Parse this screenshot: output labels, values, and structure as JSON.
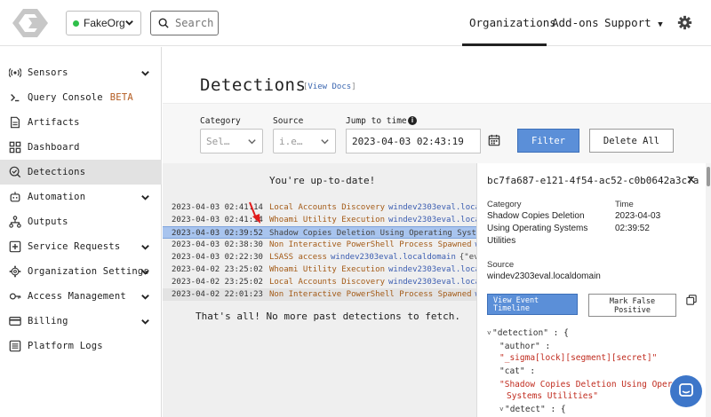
{
  "header": {
    "org_name": "FakeOrg",
    "search_placeholder": "Search",
    "nav": {
      "organizations": "Organizations",
      "addons": "Add-ons",
      "support": "Support"
    }
  },
  "sidebar": {
    "items": [
      {
        "label": "Sensors",
        "icon": "sensors-icon"
      },
      {
        "label": "Query Console",
        "badge": "BETA",
        "icon": "query-console-icon"
      },
      {
        "label": "Artifacts",
        "icon": "artifacts-icon"
      },
      {
        "label": "Dashboard",
        "icon": "dashboard-icon"
      },
      {
        "label": "Detections",
        "icon": "detections-icon",
        "active": true
      },
      {
        "label": "Automation",
        "icon": "automation-icon"
      },
      {
        "label": "Outputs",
        "icon": "outputs-icon"
      },
      {
        "label": "Service Requests",
        "icon": "service-requests-icon"
      },
      {
        "label": "Organization Settings",
        "icon": "organization-settings-icon"
      },
      {
        "label": "Access Management",
        "icon": "access-management-icon"
      },
      {
        "label": "Billing",
        "icon": "billing-icon"
      },
      {
        "label": "Platform Logs",
        "icon": "platform-logs-icon"
      }
    ]
  },
  "page": {
    "title": "Detections",
    "view_docs": "View Docs",
    "filters": {
      "category_label": "Category",
      "category_placeholder": "Sel…",
      "source_label": "Source",
      "source_placeholder": "i.e…",
      "jump_label": "Jump to time",
      "jump_value": "2023-04-03 02:43:19",
      "filter_button": "Filter",
      "delete_button": "Delete All"
    },
    "up_to_date": "You're up-to-date!",
    "thats_all": "That's all! No more past detections to fetch."
  },
  "detections": [
    {
      "time": "2023-04-03 02:41:14",
      "name": "Local Accounts Discovery",
      "host": "windev2303eval.loca",
      "extra": ""
    },
    {
      "time": "2023-04-03 02:41:14",
      "name": "Whoami Utility Execution",
      "host": "windev2303eval.loca",
      "extra": ""
    },
    {
      "time": "2023-04-03 02:39:52",
      "name": "Shadow Copies Deletion Using Operating Syste",
      "host": "",
      "extra": "",
      "selected": true
    },
    {
      "time": "2023-04-03 02:38:30",
      "name": "Non Interactive PowerShell Process Spawned",
      "host": "w",
      "extra": ""
    },
    {
      "time": "2023-04-03 02:22:30",
      "name": "LSASS access",
      "host": "windev2303eval.localdomain",
      "extra": "{\"ev"
    },
    {
      "time": "2023-04-02 23:25:02",
      "name": "Whoami Utility Execution",
      "host": "windev2303eval.loca",
      "extra": ""
    },
    {
      "time": "2023-04-02 23:25:02",
      "name": "Local Accounts Discovery",
      "host": "windev2303eval.loca",
      "extra": ""
    },
    {
      "time": "2023-04-02 22:01:23",
      "name": "Non Interactive PowerShell Process Spawned",
      "host": "w",
      "extra": ""
    }
  ],
  "panel": {
    "id": "bc7fa687-e121-4f54-ac52-c0b0642a3c7a",
    "category_label": "Category",
    "category_value": "Shadow Copies Deletion Using Operating Systems Utilities",
    "category_lines": [
      "Shadow Copies Deletion",
      "Using Operating Systems",
      "Utilities"
    ],
    "time_label": "Time",
    "time_date": "2023-04-03",
    "time_clock": "02:39:52",
    "source_label": "Source",
    "source_value": "windev2303eval.localdomain",
    "timeline_button_line1": "View Event",
    "timeline_button_line2": "Timeline",
    "false_positive_line1": "Mark False",
    "false_positive_line2": "Positive",
    "json": {
      "detection_key": "\"detection\"",
      "detection_open": " : {",
      "author_key": "\"author\"",
      "author_sep": " :",
      "author_value": "\"_sigma[lock][segment][secret]\"",
      "cat_key": "\"cat\"",
      "cat_sep": " :",
      "cat_value_1": "\"Shadow Copies Deletion Using Oper",
      "cat_value_2": "Systems Utilities\"",
      "detect_key": "\"detect\"",
      "detect_open": " : {"
    }
  },
  "colors": {
    "accent": "#5b8fd8",
    "selected_row": "#a8c4ee",
    "detection_name": "#a35a16",
    "host": "#3a5cb0",
    "json_string": "#c02b1e",
    "org_status": "#2fbf4a"
  }
}
